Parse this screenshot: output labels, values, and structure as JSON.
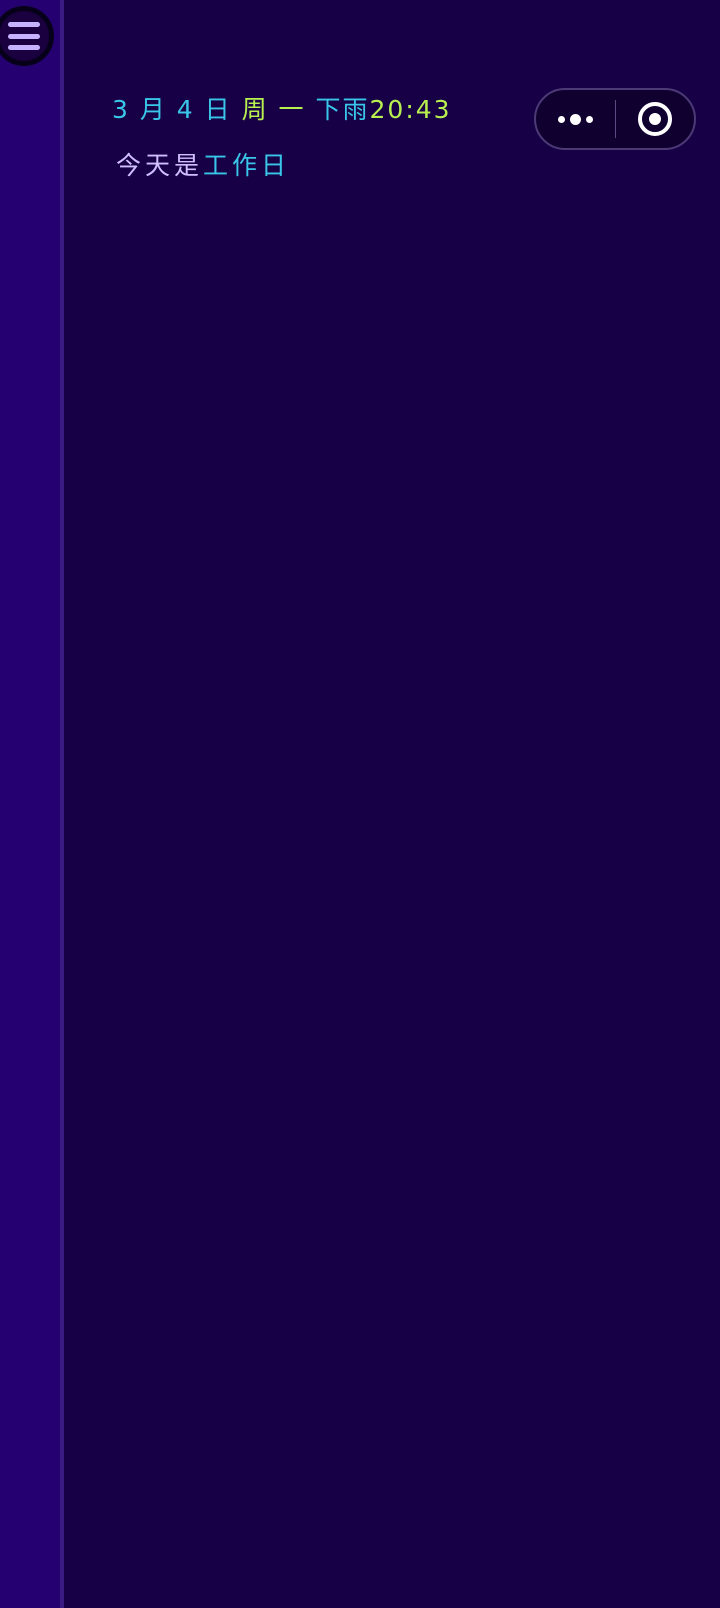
{
  "header": {
    "date": "3 月 4 日",
    "weekday": "周 一",
    "weather": "下雨",
    "time": "20:43"
  },
  "today": {
    "prefix": "今天是",
    "type": "工作日"
  },
  "icons": {
    "menu": "hamburger-menu-icon",
    "more": "more-dots-icon",
    "close": "target-circle-icon"
  },
  "colors": {
    "background": "#170046",
    "sidebar": "#240070",
    "accent_cyan": "#39c6e8",
    "accent_lime": "#b8f050",
    "lavender": "#d0bfff"
  }
}
